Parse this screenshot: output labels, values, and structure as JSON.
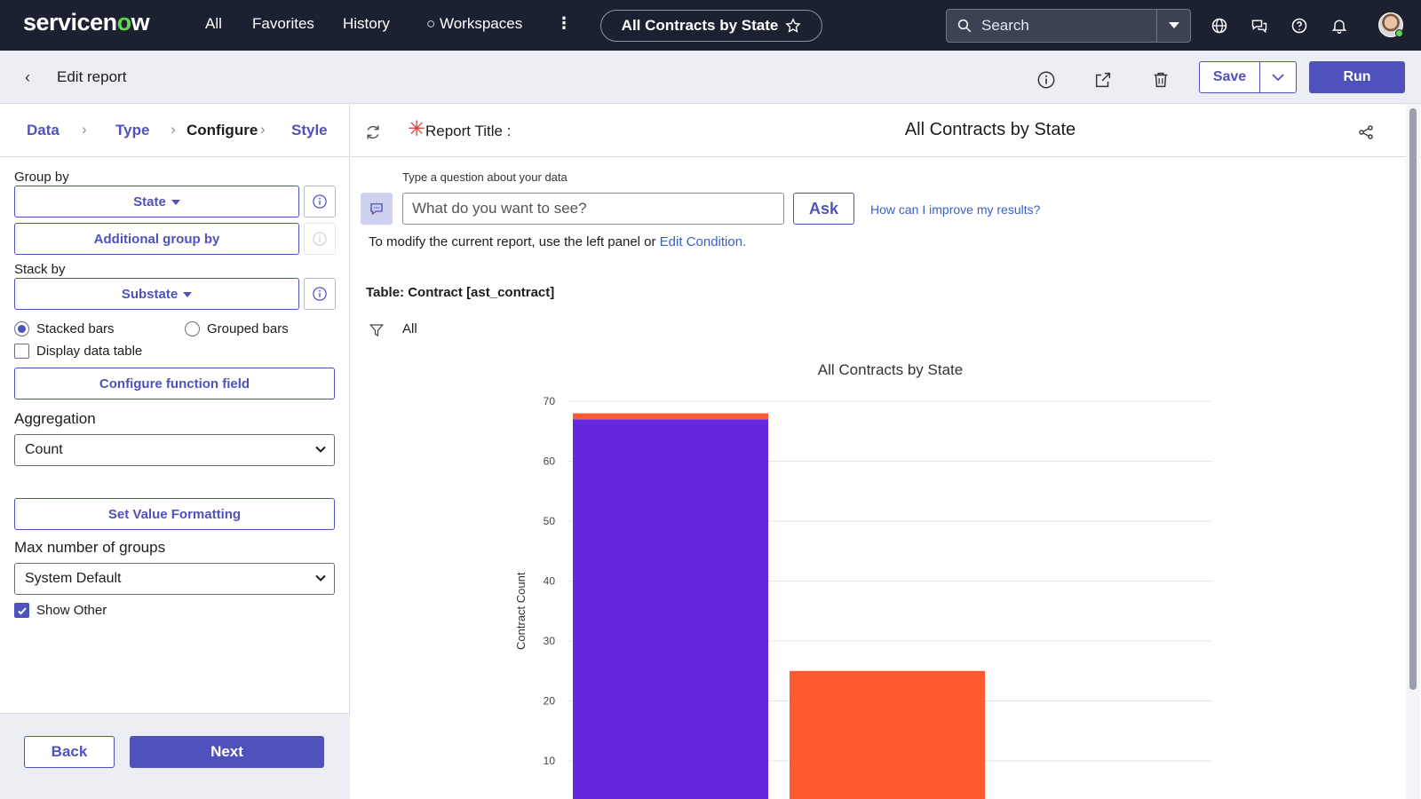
{
  "topnav": {
    "logo_text_a": "servicen",
    "logo_text_o": "o",
    "logo_text_b": "w",
    "links": [
      "All",
      "Favorites",
      "History"
    ],
    "workspaces": "○ Workspaces",
    "more": "⋮",
    "title_pill": "All Contracts by State",
    "search_placeholder": "Search"
  },
  "subhead": {
    "title": "Edit report",
    "save_label": "Save",
    "run_label": "Run"
  },
  "steps": {
    "data": "Data",
    "type": "Type",
    "configure": "Configure",
    "style": "Style"
  },
  "left": {
    "group_by_label": "Group by",
    "group_by_value": "State",
    "additional_group_by": "Additional group by",
    "stack_by_label": "Stack by",
    "stack_by_value": "Substate",
    "stacked_bars": "Stacked bars",
    "grouped_bars": "Grouped bars",
    "display_data_table": "Display data table",
    "configure_function_field": "Configure function field",
    "aggregation_label": "Aggregation",
    "aggregation_value": "Count",
    "set_value_formatting": "Set Value Formatting",
    "max_groups_label": "Max number of groups",
    "max_groups_value": "System Default",
    "show_other": "Show Other",
    "back": "Back",
    "next": "Next"
  },
  "main": {
    "report_title_label": "Report Title :",
    "report_title_value": "All Contracts by State",
    "nlq_label": "Type a question about your data",
    "nlq_placeholder": "What do you want to see?",
    "ask": "Ask",
    "improve_link": "How can I improve my results?",
    "modify_text": "To modify the current report, use the left panel or ",
    "edit_condition": "Edit Condition.",
    "table_name": "Table: Contract [ast_contract]",
    "filter_value": "All"
  },
  "colors": {
    "accent": "#4f52bd",
    "nav_bg": "#1b2130",
    "series_purple": "#6327dd",
    "series_orange": "#ff5a30"
  },
  "chart_data": {
    "type": "bar",
    "title": "All Contracts by State",
    "ylabel": "Contract Count",
    "xlabel": "",
    "ylim": [
      0,
      70
    ],
    "yticks": [
      10,
      20,
      30,
      40,
      50,
      60,
      70
    ],
    "stacked": true,
    "bars": [
      {
        "segments": [
          {
            "value": 67,
            "color": "#6327dd"
          },
          {
            "value": 1,
            "color": "#ff5a30"
          }
        ]
      },
      {
        "segments": [
          {
            "value": 25,
            "color": "#ff5a30"
          }
        ]
      }
    ]
  }
}
